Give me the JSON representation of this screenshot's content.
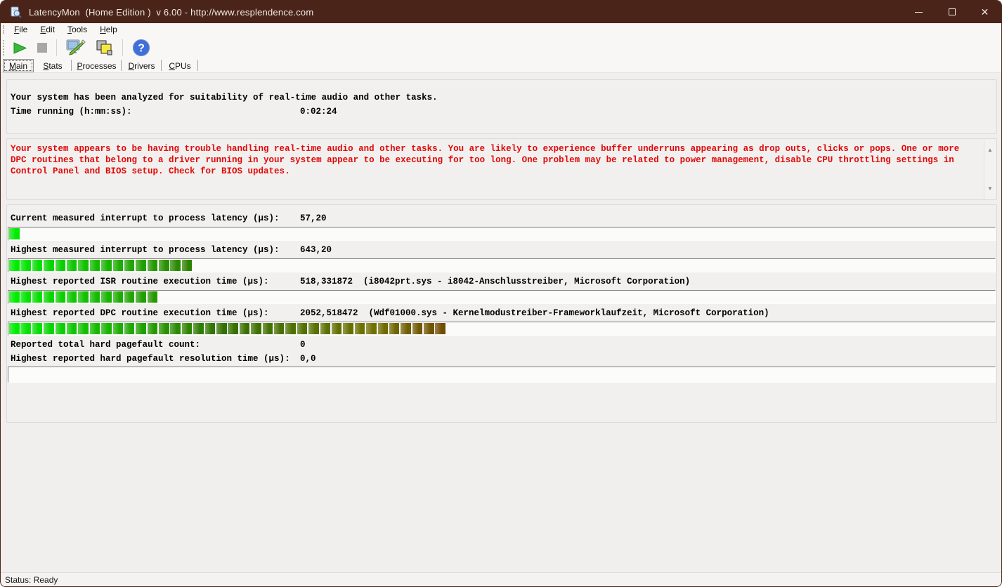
{
  "window": {
    "title": "LatencyMon  (Home Edition )  v 6.00 - http://www.resplendence.com",
    "titlebar_color": "#4a2418",
    "controls": {
      "minimize": "minimize",
      "maximize": "maximize",
      "close": "✕"
    }
  },
  "menu": {
    "items": [
      "File",
      "Edit",
      "Tools",
      "Help"
    ]
  },
  "toolbar": {
    "buttons": [
      {
        "name": "start-monitor-button",
        "icon": "play-icon"
      },
      {
        "name": "stop-monitor-button",
        "icon": "stop-icon"
      },
      {
        "name": "options-button",
        "icon": "monitor-wrench-icon"
      },
      {
        "name": "copy-report-button",
        "icon": "layers-icon"
      },
      {
        "name": "help-button",
        "icon": "help-icon"
      }
    ]
  },
  "tabs": {
    "items": [
      "Main",
      "Stats",
      "Processes",
      "Drivers",
      "CPUs"
    ],
    "active": "Main"
  },
  "analysis": {
    "line1": "Your system has been analyzed for suitability of real-time audio and other tasks.",
    "time_label": "Time running (h:mm:ss):",
    "time_value": "0:02:24"
  },
  "warning": {
    "text": "Your system appears to be having trouble handling real-time audio and other tasks. You are likely to experience buffer underruns appearing as drop outs, clicks or pops. One or more DPC routines that belong to a driver running in your system appear to be executing for too long. One problem may be related to power management, disable CPU throttling settings in Control Panel and BIOS setup. Check for BIOS updates.",
    "color": "#e00909"
  },
  "meters": [
    {
      "label": "Current measured interrupt to process latency (µs):",
      "value": "57,20",
      "detail": "",
      "segments": 1
    },
    {
      "label": "Highest measured interrupt to process latency (µs):",
      "value": "643,20",
      "detail": "",
      "segments": 16
    },
    {
      "label": "Highest reported ISR routine execution time (µs):",
      "value": "518,331872",
      "detail": "(i8042prt.sys - i8042-Anschlusstreiber, Microsoft Corporation)",
      "segments": 13
    },
    {
      "label": "Highest reported DPC routine execution time (µs):",
      "value": "2052,518472",
      "detail": "(Wdf01000.sys - Kernelmodustreiber-Frameworklaufzeit, Microsoft Corporation)",
      "segments": 38
    }
  ],
  "pagefaults": [
    {
      "label": "Reported total hard pagefault count:",
      "value": "0"
    },
    {
      "label": "Highest reported hard pagefault resolution time (µs):",
      "value": "0,0"
    }
  ],
  "statusbar": {
    "text": "Status: Ready"
  },
  "colors": {
    "bar_green_start": "#00eb00",
    "bar_green_dark": "#2b8300",
    "bar_brown_end": "#704e00"
  }
}
